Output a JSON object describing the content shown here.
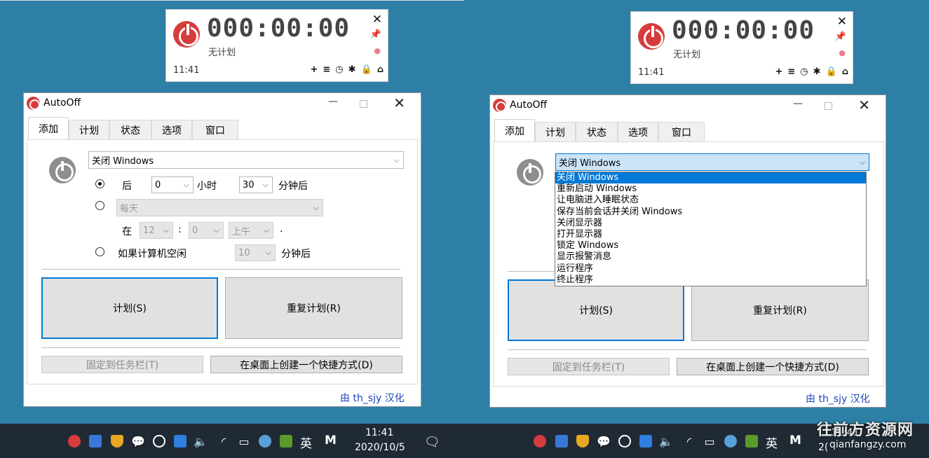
{
  "timer": {
    "digits": "000:00:00",
    "plan_status": "无计划",
    "clock": "11:41",
    "close_glyph": "✕",
    "pin_glyph": "✚",
    "drop_glyph": "●",
    "tools": [
      "+",
      "≡",
      "◷",
      "✱",
      "🔒",
      "⌂"
    ]
  },
  "window": {
    "title": "AutoOff",
    "tabs": [
      "添加",
      "计划",
      "状态",
      "选项",
      "窗口"
    ],
    "action_select": "关闭 Windows",
    "after_label": "后",
    "hours_value": "0",
    "hours_unit": "小时",
    "minutes_value": "30",
    "minutes_unit": "分钟后",
    "daily_value": "每天",
    "at_label": "在",
    "at_hour": "12",
    "colon": ":",
    "at_minute": "0",
    "ampm": "上午",
    "period": ".",
    "idle_label": "如果计算机空闲",
    "idle_value": "10",
    "idle_unit": "分钟后",
    "plan_button": "计划(S)",
    "repeat_button": "重复计划(R)",
    "pin_taskbar_button": "固定到任务栏(T)",
    "shortcut_button": "在桌面上创建一个快捷方式(D)",
    "credit": "由 th_sjy 汉化",
    "dropdown_options": [
      "关闭 Windows",
      "重新启动 Windows",
      "让电脑进入睡眠状态",
      "保存当前会话并关闭 Windows",
      "关闭显示器",
      "打开显示器",
      "锁定 Windows",
      "显示报警消息",
      "运行程序",
      "终止程序"
    ]
  },
  "taskbar": {
    "time": "11:41",
    "date": "2020/10/5",
    "ime": "英",
    "m_icon": "M",
    "date_partial": "2(",
    "time_partial": "11:41"
  },
  "watermark": {
    "line1": "往前方资源网",
    "line2": "qianfangzy.com"
  },
  "colors": {
    "desktop": "#2d7fa6",
    "power_red": "#d63c3c",
    "accent_blue": "#0078d7",
    "taskbar": "#1f2a35"
  }
}
